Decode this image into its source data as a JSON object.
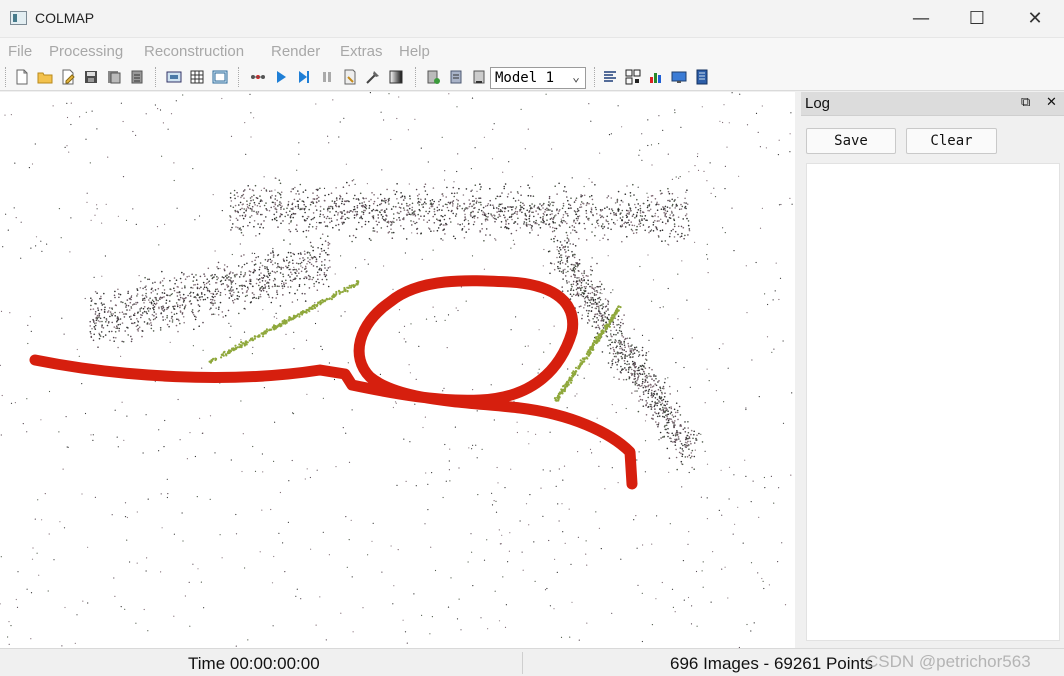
{
  "window": {
    "title": "COLMAP",
    "minimize": "—",
    "maximize": "☐",
    "close": "✕"
  },
  "menu": [
    "File",
    "Processing",
    "Reconstruction",
    "Render",
    "Extras",
    "Help"
  ],
  "toolbar": {
    "model_selected": "Model 1",
    "icons": [
      "new-project-icon",
      "open-project-icon",
      "edit-project-icon",
      "save-project-icon",
      "import-model-icon",
      "export-model-icon",
      "feature-extraction-icon",
      "feature-matching-icon",
      "database-icon",
      "reconstruction-options-icon",
      "start-reconstruction-icon",
      "step-reconstruction-icon",
      "pause-reconstruction-icon",
      "reset-icon",
      "bundle-adjustment-icon",
      "dense-reconstruction-icon",
      "render-options-icon",
      "add-model-icon",
      "remove-model-icon",
      "model-stats-icon",
      "grid-icon",
      "match-matrix-icon",
      "statistics-icon",
      "screenshot-icon",
      "movie-icon"
    ]
  },
  "log": {
    "title": "Log",
    "save_label": "Save",
    "clear_label": "Clear",
    "float_icon": "float-dock-icon",
    "close_icon": "close-dock-icon"
  },
  "status": {
    "time": "Time 00:00:00:00",
    "counts": "696 Images - 69261 Points",
    "watermark": "CSDN @petrichor563"
  },
  "colors": {
    "annotation_red": "#d61f0e",
    "camera_trail": "#8fa83c"
  }
}
